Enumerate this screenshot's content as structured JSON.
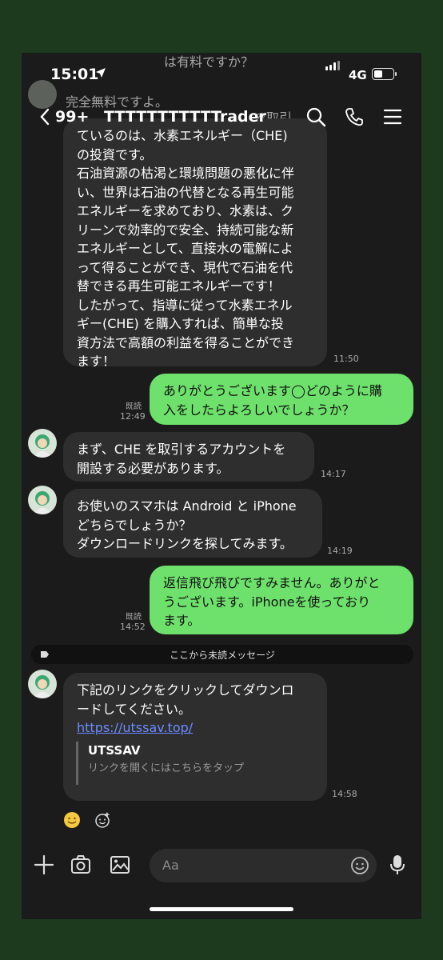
{
  "status": {
    "time": "15:01",
    "network": "4G"
  },
  "header": {
    "unread_count": "99+",
    "title": "TTTTTTTTTTTrader"
  },
  "background_peek": {
    "top_msg": "は有料ですか？",
    "side_msg": "完全無料ですよ。",
    "side_msg2": "で取引"
  },
  "messages": [
    {
      "id": "m1",
      "dir": "in",
      "text_lines": [
        "ているのは、水素エネルギー（CHE)",
        "の投資です。",
        "石油資源の枯渇と環境問題の悪化に伴",
        "い、世界は石油の代替となる再生可能",
        "エネルギーを求めており、水素は、ク",
        "リーンで効率的で安全、持続可能な新",
        "エネルギーとして、直接水の電解によ",
        "って得ることができ、現代で石油を代",
        "替できる再生可能エネルギーです！",
        "したがって、指導に従って水素エネル",
        "ギー(CHE) を購入すれば、簡単な投",
        "資方法で高額の利益を得ることができ",
        "ます！"
      ],
      "time": "11:50"
    },
    {
      "id": "m2",
      "dir": "out",
      "text_lines": [
        "ありがとうございます◯どのように購",
        "入をしたらよろしいでしょうか？"
      ],
      "read": "既読",
      "time": "12:49"
    },
    {
      "id": "m3",
      "dir": "in",
      "text_lines": [
        "まず、CHE を取引するアカウントを",
        "開設する必要があります。"
      ],
      "time": "14:17"
    },
    {
      "id": "m4",
      "dir": "in",
      "text_lines": [
        "お使いのスマホは Android と iPhone",
        "どちらでしょうか？",
        "ダウンロードリンクを探してみます。"
      ],
      "time": "14:19"
    },
    {
      "id": "m5",
      "dir": "out",
      "text_lines": [
        "返信飛び飛びですみません。ありがと",
        "うございます。iPhoneを使っており",
        "ます。"
      ],
      "read": "既読",
      "time": "14:52"
    },
    {
      "id": "m6",
      "dir": "in",
      "text_lines": [
        "下記のリンクをクリックしてダウンロ",
        "ードしてください。"
      ],
      "link": "https://utssav.top/",
      "preview_title": "UTSSAV",
      "preview_sub": "リンクを開くにはこちらをタップ",
      "time": "14:58"
    }
  ],
  "unread_banner": "ここから未読メッセージ",
  "input": {
    "placeholder": "Aa"
  },
  "colors": {
    "outgoing_bubble": "#6ee06c",
    "incoming_bubble": "#2e2e2e",
    "link": "#6b8cff"
  }
}
